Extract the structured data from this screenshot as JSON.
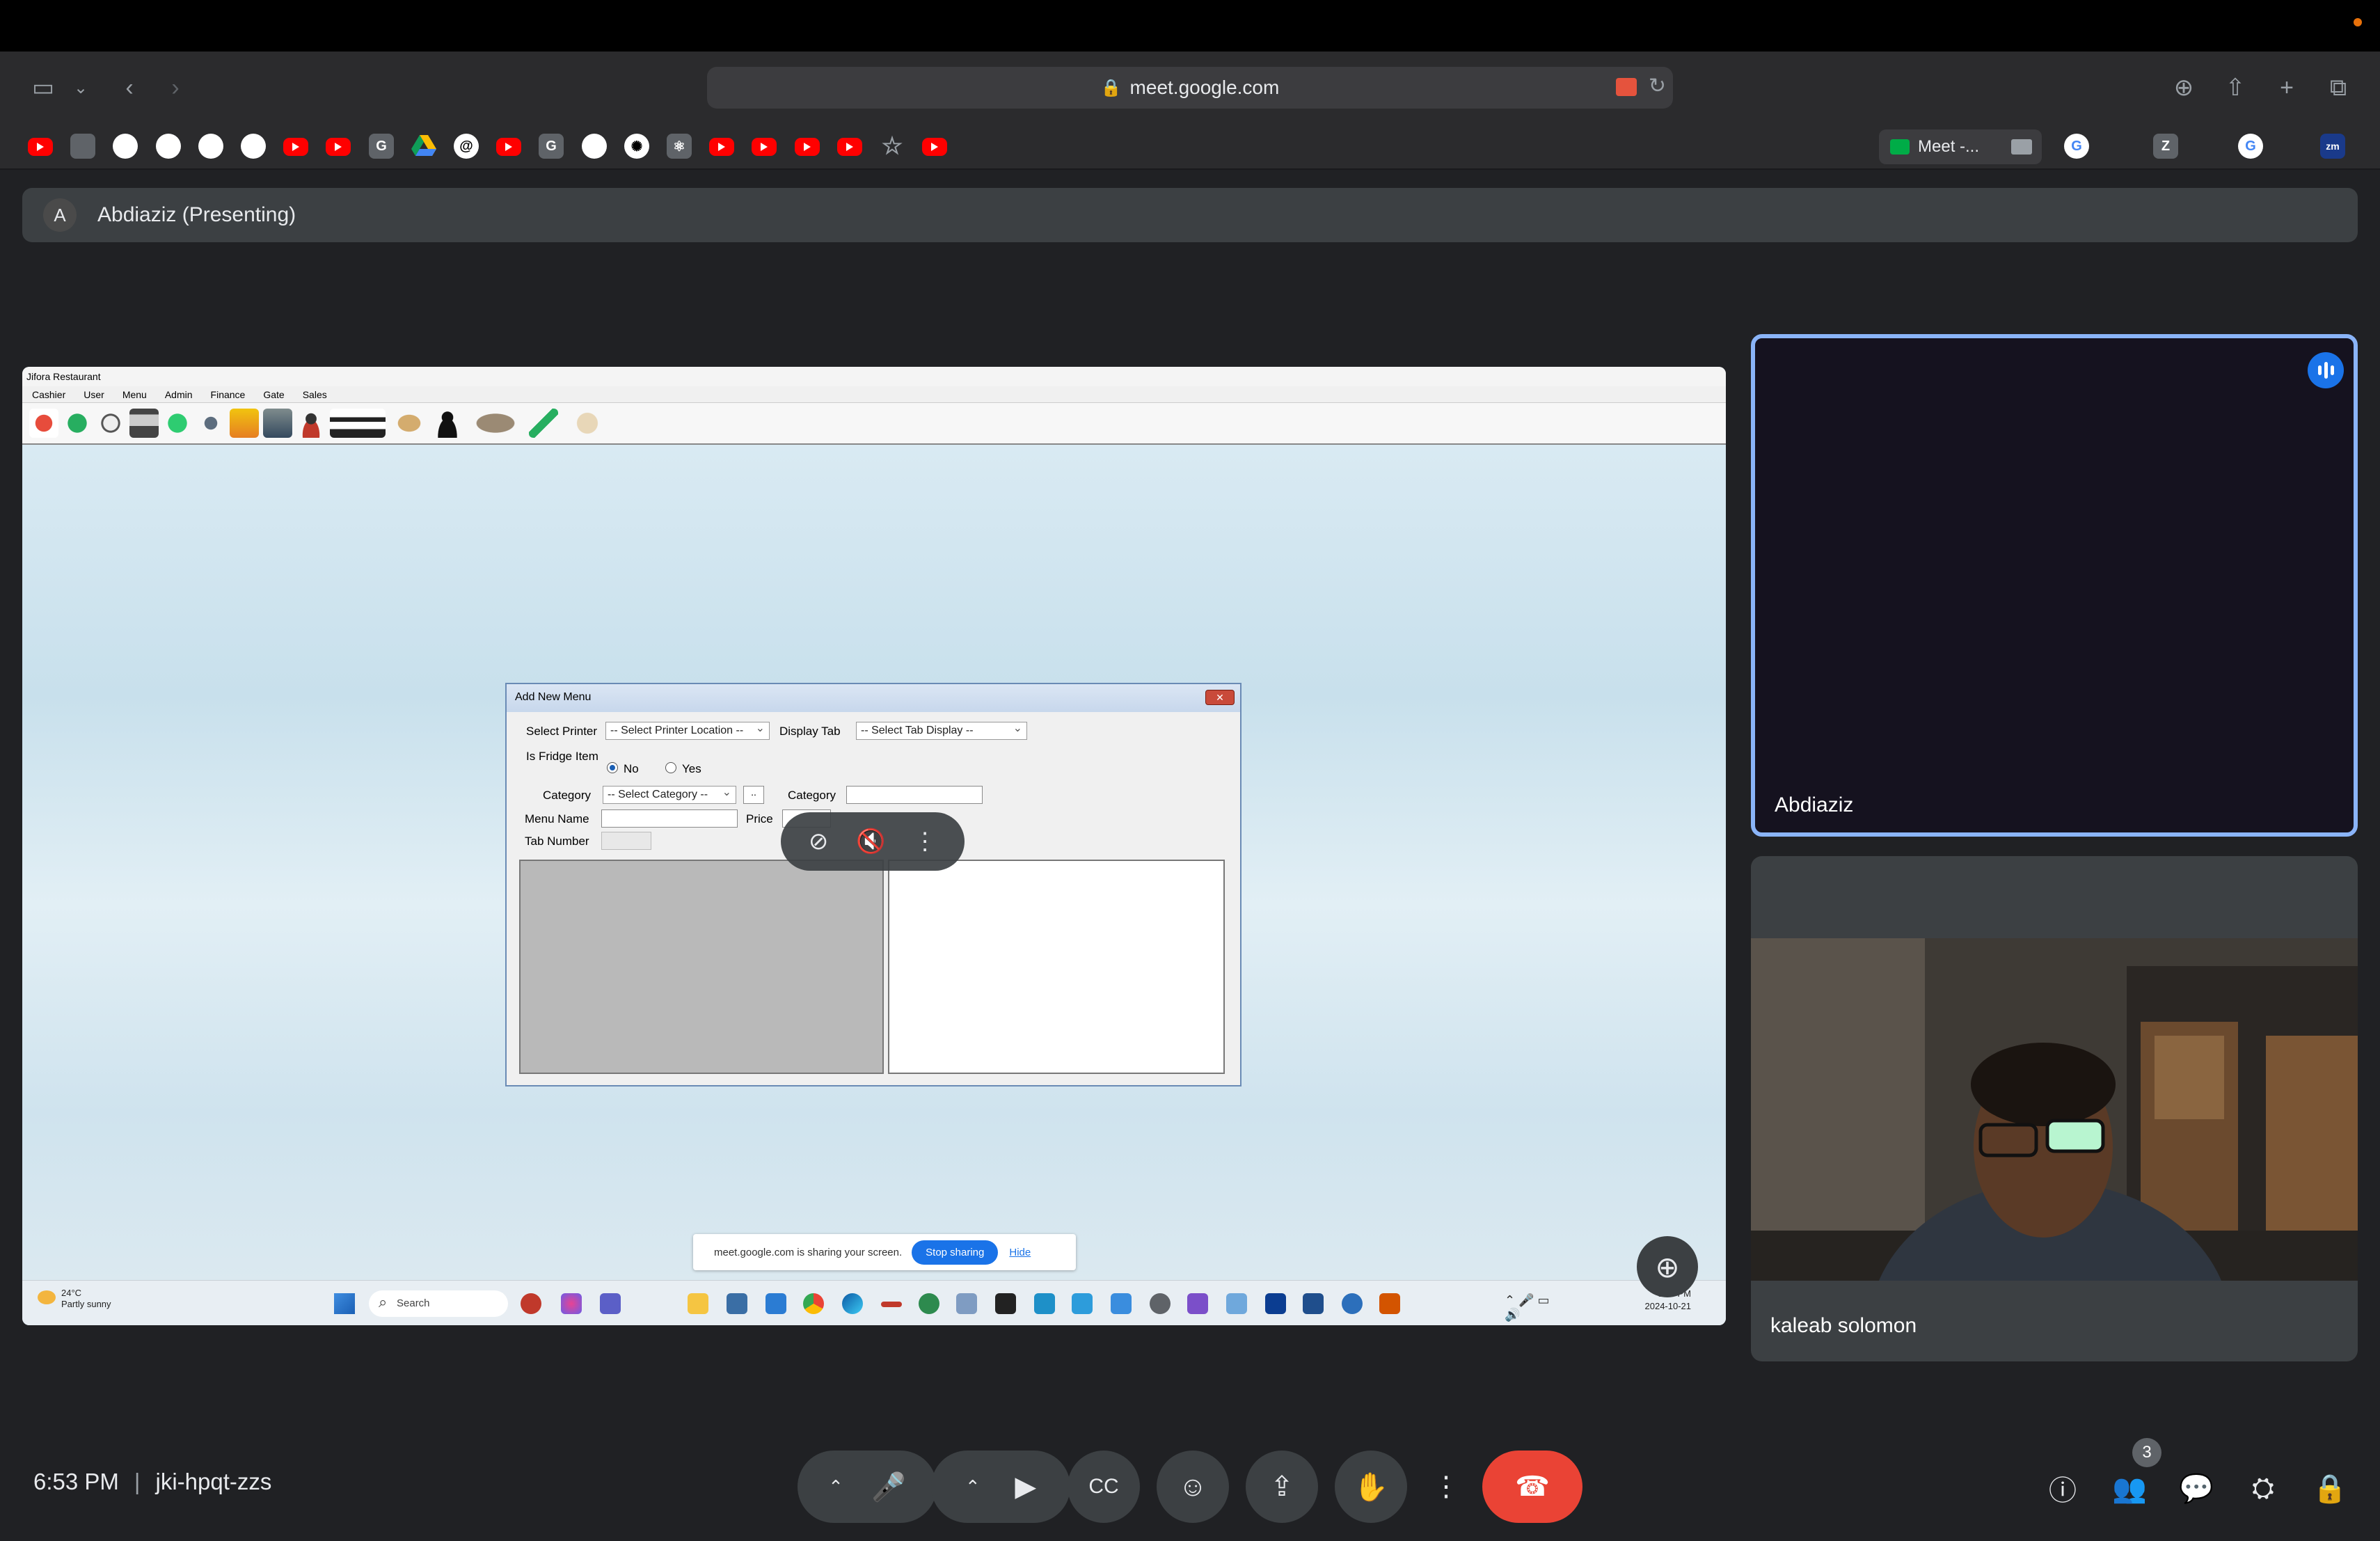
{
  "browser": {
    "url": "meet.google.com",
    "active_tab_label": "Meet -...",
    "bookmarks": [
      {
        "icon": "youtube-icon",
        "kind": "yt"
      },
      {
        "icon": "calendar-app-icon",
        "kind": "gray"
      },
      {
        "icon": "github-icon",
        "kind": "gh"
      },
      {
        "icon": "github-icon",
        "kind": "gh"
      },
      {
        "icon": "github-icon",
        "kind": "gh"
      },
      {
        "icon": "github-icon",
        "kind": "gh"
      },
      {
        "icon": "youtube-icon",
        "kind": "yt"
      },
      {
        "icon": "youtube-icon",
        "kind": "yt"
      },
      {
        "icon": "grammarly-icon",
        "kind": "gray",
        "text": "G"
      },
      {
        "icon": "google-drive-icon",
        "kind": "drive"
      },
      {
        "icon": "threads-icon",
        "kind": "gh",
        "text": "@"
      },
      {
        "icon": "youtube-icon",
        "kind": "yt"
      },
      {
        "icon": "grammarly-icon",
        "kind": "gray",
        "text": "G"
      },
      {
        "icon": "github-icon",
        "kind": "gh"
      },
      {
        "icon": "chatgpt-icon",
        "kind": "gh",
        "text": "✺"
      },
      {
        "icon": "react-icon",
        "kind": "gray",
        "text": "⚛"
      },
      {
        "icon": "youtube-icon",
        "kind": "yt"
      },
      {
        "icon": "youtube-icon",
        "kind": "yt"
      },
      {
        "icon": "youtube-icon",
        "kind": "yt"
      },
      {
        "icon": "youtube-icon",
        "kind": "yt"
      },
      {
        "icon": "star-icon",
        "kind": "star",
        "text": "☆"
      },
      {
        "icon": "youtube-icon",
        "kind": "yt"
      }
    ],
    "right_tabs": [
      {
        "icon": "google-icon",
        "kind": "white",
        "text": "G"
      },
      {
        "icon": "zlibrary-icon",
        "kind": "gray",
        "text": "Z"
      },
      {
        "icon": "google-icon",
        "kind": "white",
        "text": "G"
      },
      {
        "icon": "zoom-icon",
        "kind": "blue",
        "text": "zm"
      }
    ]
  },
  "meet": {
    "presenter_initial": "A",
    "presenting_label": "Abdiaziz (Presenting)",
    "time": "6:53 PM",
    "separator": "|",
    "meeting_code": "jki-hpqt-zzs",
    "participants_count": "3",
    "tiles": [
      {
        "name": "Abdiaziz"
      },
      {
        "name": "kaleab solomon"
      }
    ],
    "share_notice": {
      "text": "meet.google.com is sharing your screen.",
      "stop_label": "Stop sharing",
      "hide_label": "Hide"
    }
  },
  "shared_app": {
    "window_title": "Jifora Restaurant",
    "menu": [
      "Cashier",
      "User",
      "Menu",
      "Admin",
      "Finance",
      "Gate",
      "Sales"
    ],
    "dialog": {
      "title": "Add New Menu",
      "close_label": "✕",
      "select_printer_label": "Select Printer",
      "select_printer_value": "-- Select Printer Location --",
      "display_tab_label": "Display Tab",
      "display_tab_value": "-- Select Tab Display --",
      "fridge_label": "Is Fridge Item",
      "radio_no": "No",
      "radio_yes": "Yes",
      "category_label": "Category",
      "category_value": "-- Select Category --",
      "add_category_button": "..",
      "category_text_label": "Category",
      "menu_name_label": "Menu Name",
      "price_label": "Price",
      "tab_number_label": "Tab Number"
    },
    "taskbar": {
      "weather_temp": "24°C",
      "weather_desc": "Partly sunny",
      "search_placeholder": "Search",
      "clock_time": "6:53 PM",
      "clock_date": "2024-10-21"
    }
  }
}
